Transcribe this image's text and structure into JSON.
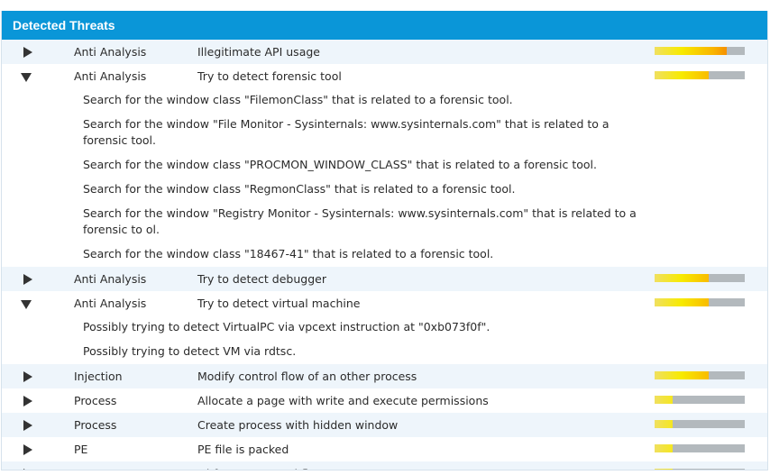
{
  "header": {
    "title": "Detected Threats"
  },
  "threats": [
    {
      "category": "Anti Analysis",
      "description": "Illegitimate API usage",
      "severity": 0.8,
      "expanded": false,
      "details": []
    },
    {
      "category": "Anti Analysis",
      "description": "Try to detect forensic tool",
      "severity": 0.6,
      "expanded": true,
      "details": [
        "Search for the window class \"FilemonClass\" that is related to a forensic tool.",
        "Search for the window \"File Monitor - Sysinternals: www.sysinternals.com\" that is related to a forensic tool.",
        "Search for the window class \"PROCMON_WINDOW_CLASS\" that is related to a forensic tool.",
        "Search for the window class \"RegmonClass\" that is related to a forensic tool.",
        "Search for the window \"Registry Monitor - Sysinternals: www.sysinternals.com\" that is related to a forensic to ol.",
        "Search for the window class \"18467-41\" that is related to a forensic tool."
      ]
    },
    {
      "category": "Anti Analysis",
      "description": "Try to detect debugger",
      "severity": 0.6,
      "expanded": false,
      "details": []
    },
    {
      "category": "Anti Analysis",
      "description": "Try to detect virtual machine",
      "severity": 0.6,
      "expanded": true,
      "details": [
        "Possibly trying to detect VirtualPC via vpcext instruction at \"0xb073f0f\".",
        "Possibly trying to detect VM via rdtsc."
      ]
    },
    {
      "category": "Injection",
      "description": "Modify control flow of an other process",
      "severity": 0.6,
      "expanded": false,
      "details": []
    },
    {
      "category": "Process",
      "description": "Allocate a page with write and execute permissions",
      "severity": 0.2,
      "expanded": false,
      "details": []
    },
    {
      "category": "Process",
      "description": "Create process with hidden window",
      "severity": 0.2,
      "expanded": false,
      "details": []
    },
    {
      "category": "PE",
      "description": "PE file is packed",
      "severity": 0.2,
      "expanded": false,
      "details": []
    },
    {
      "category": "Process",
      "description": "Obfuscate control flow",
      "severity": 0.2,
      "expanded": false,
      "details": []
    }
  ],
  "colors": {
    "header_bg": "#0a96d8",
    "row_alt_bg": "#eef5fb",
    "bar_track": "#b3b9bd",
    "bar_low": "#f7ea00",
    "bar_high": "#f16000"
  }
}
